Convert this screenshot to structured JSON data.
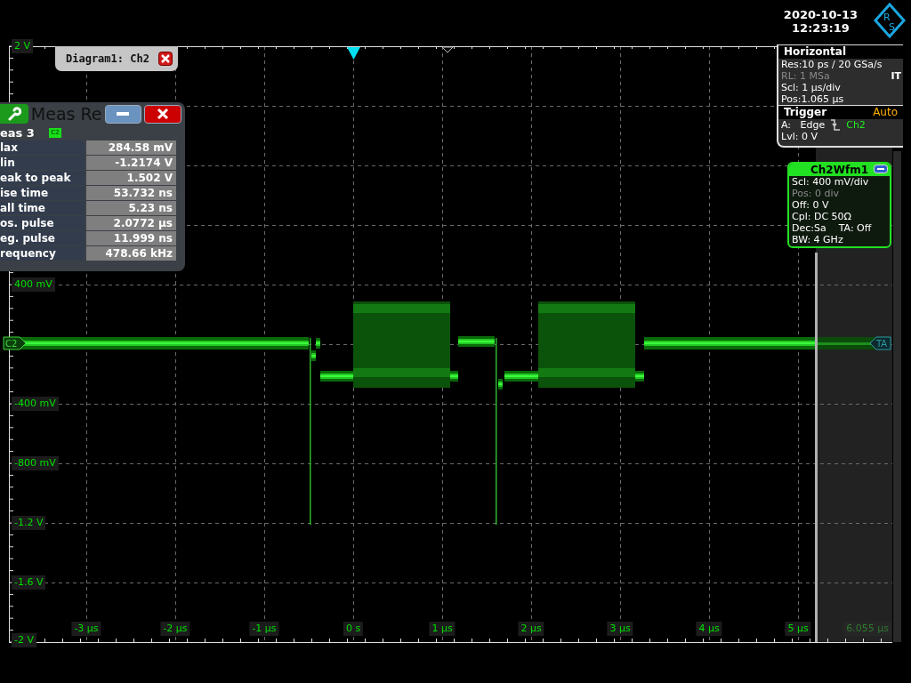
{
  "header": {
    "date": "2020-10-13",
    "time": "12:23:19",
    "logo_letters": [
      "R",
      "S"
    ]
  },
  "diagram": {
    "title": "Diagram1: Ch2",
    "channel_marker": "C2",
    "trigger_marker": "TA",
    "y_labels": [
      "2 V",
      "400 mV",
      "-400 mV",
      "-800 mV",
      "-1.2 V",
      "-1.6 V",
      "-2 V"
    ],
    "x_labels": [
      "-3 µs",
      "-2 µs",
      "-1 µs",
      "0 s",
      "1 µs",
      "2 µs",
      "3 µs",
      "4 µs",
      "5 µs",
      "6.055 µs"
    ]
  },
  "measurement": {
    "title": "Meas Re",
    "subtitle": "eas 3",
    "source_badge": "C2",
    "rows": [
      {
        "name": "lax",
        "value": "284.58 mV"
      },
      {
        "name": "lin",
        "value": "-1.2174 V"
      },
      {
        "name": "eak to peak",
        "value": "1.502 V"
      },
      {
        "name": "ise time",
        "value": "53.732 ns"
      },
      {
        "name": "all time",
        "value": "5.23 ns"
      },
      {
        "name": "os. pulse",
        "value": "2.0772 µs"
      },
      {
        "name": "eg. pulse",
        "value": "11.999 ns"
      },
      {
        "name": "requency",
        "value": "478.66 kHz"
      }
    ]
  },
  "horizontal": {
    "title": "Horizontal",
    "side_label": "IT",
    "lines": [
      {
        "text": "Res:10 ps / 20 GSa/s",
        "disabled": false
      },
      {
        "text": "RL: 1 MSa",
        "disabled": true
      },
      {
        "text": "Scl: 1 µs/div",
        "disabled": false
      },
      {
        "text": "Pos:1.065 µs",
        "disabled": false
      }
    ]
  },
  "trigger": {
    "title": "Trigger",
    "mode": "Auto",
    "edge_line": "A:   Edge",
    "source": "Ch2",
    "level": "Lvl: 0 V"
  },
  "waveform_info": {
    "title": "Ch2Wfm1",
    "lines": [
      {
        "text": "Scl: 400 mV/div",
        "disabled": false
      },
      {
        "text": "Pos: 0 div",
        "disabled": true
      },
      {
        "text": "Off: 0 V",
        "disabled": false
      },
      {
        "text": "Cpl: DC 50Ω",
        "disabled": false
      },
      {
        "text": "Dec:Sa    TA: Off",
        "disabled": false
      },
      {
        "text": "BW: 4 GHz",
        "disabled": false
      }
    ]
  }
}
